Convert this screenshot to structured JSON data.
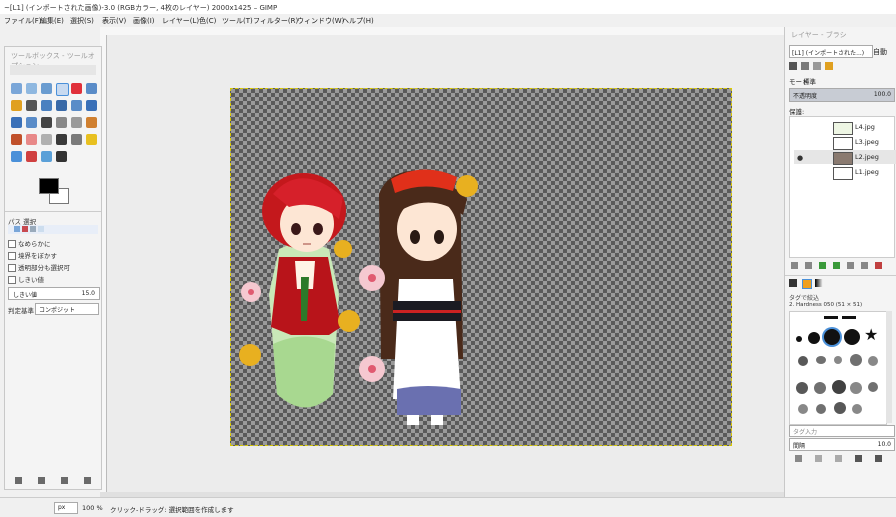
{
  "window": {
    "title": "~[L1] (インポートされた画像)-3.0 (RGBカラー, 4枚のレイヤー) 2000x1425 – GIMP"
  },
  "menu": [
    "ファイル(F)",
    "編集(E)",
    "選択(S)",
    "表示(V)",
    "画像(I)",
    "レイヤー(L)",
    "色(C)",
    "ツール(T)",
    "フィルター(R)",
    "ウィンドウ(W)",
    "ヘルプ(H)"
  ],
  "toolbox": {
    "title": "ツールボックス - ツールオプション",
    "options_title": "パス 選択",
    "checkbox_1": "なめらかに",
    "checkbox_2": "境界をぼかす",
    "checkbox_3": "透明部分も選択可",
    "checkbox_4": "しきい値",
    "threshold_label": "しきい値",
    "threshold_value": "15.0",
    "select_by_label": "判定基準",
    "select_by_value": "コンポジット"
  },
  "layers_dock": {
    "tab_title": "レイヤー - ブラシ",
    "image_select": "[L1] (インポートされた...)",
    "auto_button": "自動",
    "mode_label": "モード",
    "mode_value": "標準",
    "opacity_label": "不透明度",
    "opacity_value": "100.0",
    "lock_label": "保護:",
    "layers": [
      {
        "name": "L4.jpg",
        "visible": false
      },
      {
        "name": "L3.jpeg",
        "visible": false
      },
      {
        "name": "L2.jpeg",
        "visible": true
      },
      {
        "name": "L1.jpeg",
        "visible": false
      }
    ]
  },
  "brushes_dock": {
    "filter_label": "タグで絞込",
    "brush_name": "2. Hardness 050 (51 × 51)",
    "tag_placeholder": "タグ入力",
    "spacing_label": "間隔",
    "spacing_value": "10.0"
  },
  "status": {
    "units": "px",
    "zoom": "100 %",
    "message": "クリック-ドラッグ: 選択範囲を作成します"
  },
  "colors": {
    "accent": "#4a90d9",
    "canvas_bg": "#ececec",
    "checker_dark": "#5a5a5a",
    "checker_light": "#9a9a9a"
  }
}
